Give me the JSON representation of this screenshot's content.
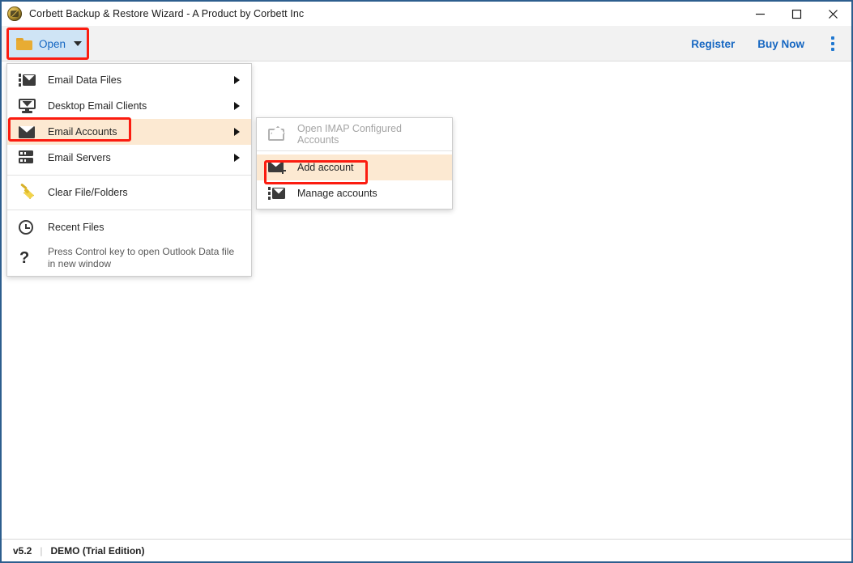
{
  "window": {
    "title": "Corbett Backup & Restore Wizard - A Product by Corbett Inc",
    "logo_icon": "app-logo-icon",
    "controls": {
      "minimize": "—",
      "maximize": "☐",
      "close": "✕"
    }
  },
  "toolbar": {
    "open_label": "Open",
    "open_icon": "folder-icon",
    "dropdown_icon": "chevron-down-icon",
    "register_label": "Register",
    "buy_now_label": "Buy Now",
    "kebab_icon": "more-vertical-icon",
    "accent_blue": "#1667c2",
    "open_button_bg": "#cfe4f5",
    "highlight_red": "#fb1c10"
  },
  "menu": {
    "items": [
      {
        "label": "Email Data Files",
        "icon": "email-data-files-icon",
        "has_submenu": true,
        "highlighted": false
      },
      {
        "label": "Desktop Email Clients",
        "icon": "desktop-email-clients-icon",
        "has_submenu": true,
        "highlighted": false
      },
      {
        "label": "Email Accounts",
        "icon": "email-accounts-icon",
        "has_submenu": true,
        "highlighted": true
      },
      {
        "label": "Email Servers",
        "icon": "email-servers-icon",
        "has_submenu": true,
        "highlighted": false
      }
    ],
    "clear": {
      "label": "Clear File/Folders",
      "icon": "broom-icon"
    },
    "recent": {
      "label": "Recent Files",
      "icon": "history-clock-icon"
    },
    "hint": {
      "label": "Press Control key to open Outlook Data file in new window",
      "icon": "question-mark-icon"
    },
    "highlight_bg": "#fce9d2"
  },
  "submenu": {
    "items": [
      {
        "label": "Open IMAP Configured Accounts",
        "icon": "open-envelope-icon",
        "disabled": true,
        "highlighted": false
      },
      {
        "label": "Add account",
        "icon": "envelope-plus-icon",
        "disabled": false,
        "highlighted": true
      },
      {
        "label": "Manage accounts",
        "icon": "manage-envelope-icon",
        "disabled": false,
        "highlighted": false
      }
    ]
  },
  "statusbar": {
    "version": "v5.2",
    "divider": "|",
    "edition": "DEMO (Trial Edition)"
  }
}
